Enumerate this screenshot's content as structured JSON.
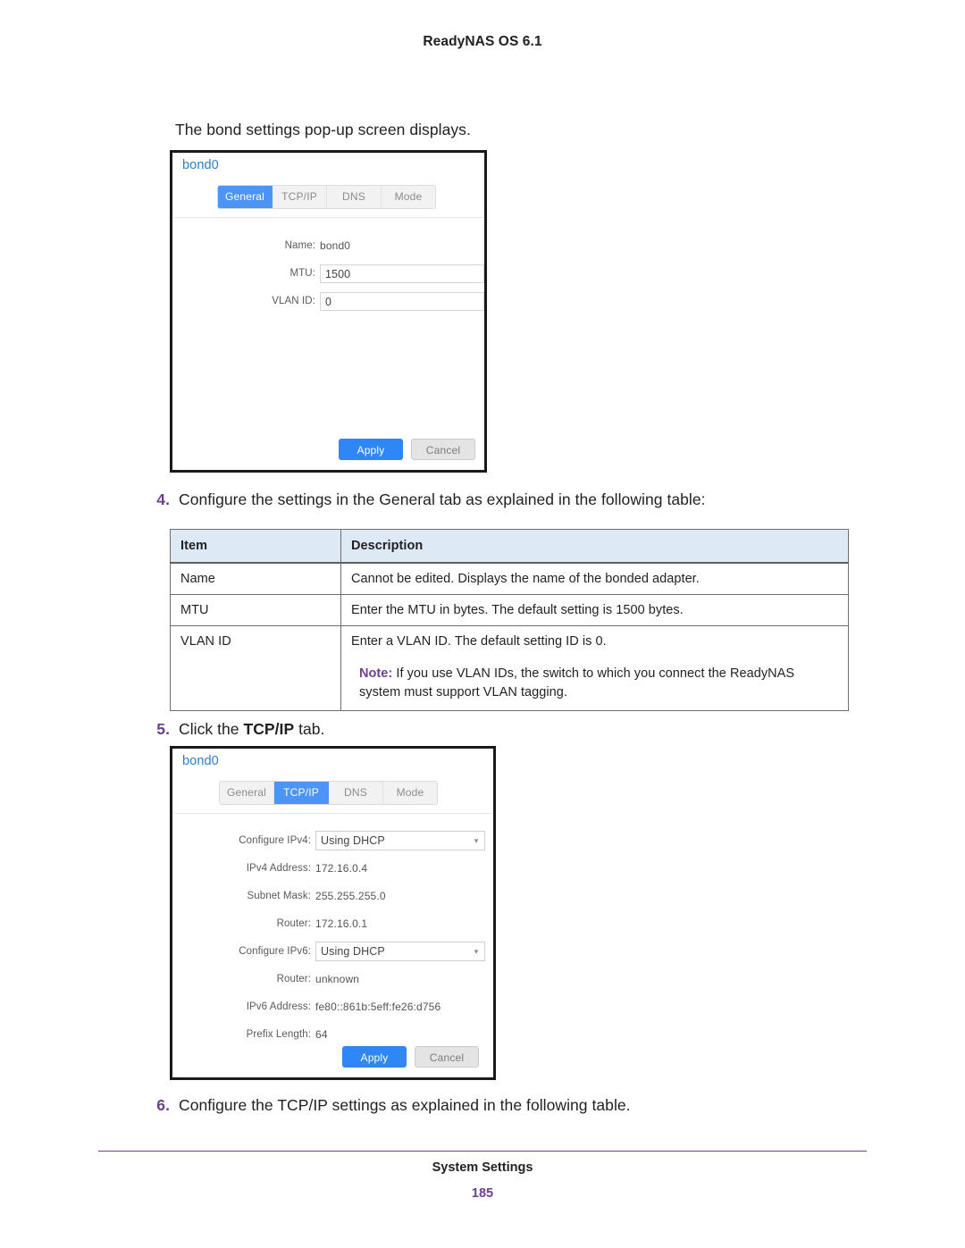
{
  "page": {
    "running_head": "ReadyNAS OS 6.1",
    "lead_text": "The bond settings pop-up screen displays.",
    "footer_title": "System Settings",
    "footer_page_number": "185",
    "accent_purple": "#6d3f8c",
    "table_header_blue": "#ddeaf6"
  },
  "steps": {
    "step4": {
      "number": "4.",
      "text": "Configure the settings in the General tab as explained in the following table:"
    },
    "step5": {
      "number": "5.",
      "prefix": "Click the ",
      "bold": "TCP/IP",
      "suffix": " tab."
    },
    "step6": {
      "number": "6.",
      "text": "Configure the TCP/IP settings as explained in the following table."
    }
  },
  "dialog_general": {
    "title": "bond0",
    "tabs": [
      {
        "label": "General",
        "active": true
      },
      {
        "label": "TCP/IP",
        "active": false
      },
      {
        "label": "DNS",
        "active": false
      },
      {
        "label": "Mode",
        "active": false
      }
    ],
    "fields": [
      {
        "label": "Name:",
        "value": "bond0",
        "type": "static"
      },
      {
        "label": "MTU:",
        "value": "1500",
        "type": "input"
      },
      {
        "label": "VLAN ID:",
        "value": "0",
        "type": "input"
      }
    ],
    "buttons": {
      "apply": "Apply",
      "cancel": "Cancel"
    }
  },
  "dialog_tcpip": {
    "title": "bond0",
    "tabs": [
      {
        "label": "General",
        "active": false
      },
      {
        "label": "TCP/IP",
        "active": true
      },
      {
        "label": "DNS",
        "active": false
      },
      {
        "label": "Mode",
        "active": false
      }
    ],
    "fields": [
      {
        "label": "Configure IPv4:",
        "value": "Using DHCP",
        "type": "select"
      },
      {
        "label": "IPv4 Address:",
        "value": "172.16.0.4",
        "type": "static"
      },
      {
        "label": "Subnet Mask:",
        "value": "255.255.255.0",
        "type": "static"
      },
      {
        "label": "Router:",
        "value": "172.16.0.1",
        "type": "static"
      },
      {
        "label": "Configure IPv6:",
        "value": "Using DHCP",
        "type": "select"
      },
      {
        "label": "Router:",
        "value": "unknown",
        "type": "static"
      },
      {
        "label": "IPv6 Address:",
        "value": "fe80::861b:5eff:fe26:d756",
        "type": "static"
      },
      {
        "label": "Prefix Length:",
        "value": "64",
        "type": "static"
      }
    ],
    "buttons": {
      "apply": "Apply",
      "cancel": "Cancel"
    }
  },
  "table": {
    "headers": [
      "Item",
      "Description"
    ],
    "rows": [
      {
        "item": "Name",
        "description": "Cannot be edited. Displays the name of the bonded adapter.",
        "note_label": "",
        "note_text": ""
      },
      {
        "item": "MTU",
        "description": "Enter the MTU in bytes. The default setting is 1500 bytes.",
        "note_label": "",
        "note_text": ""
      },
      {
        "item": "VLAN ID",
        "description": "Enter a VLAN ID. The default setting ID is 0.",
        "note_label": "Note:",
        "note_text": " If you use VLAN IDs, the switch to which you connect the ReadyNAS system must support VLAN tagging."
      }
    ]
  }
}
